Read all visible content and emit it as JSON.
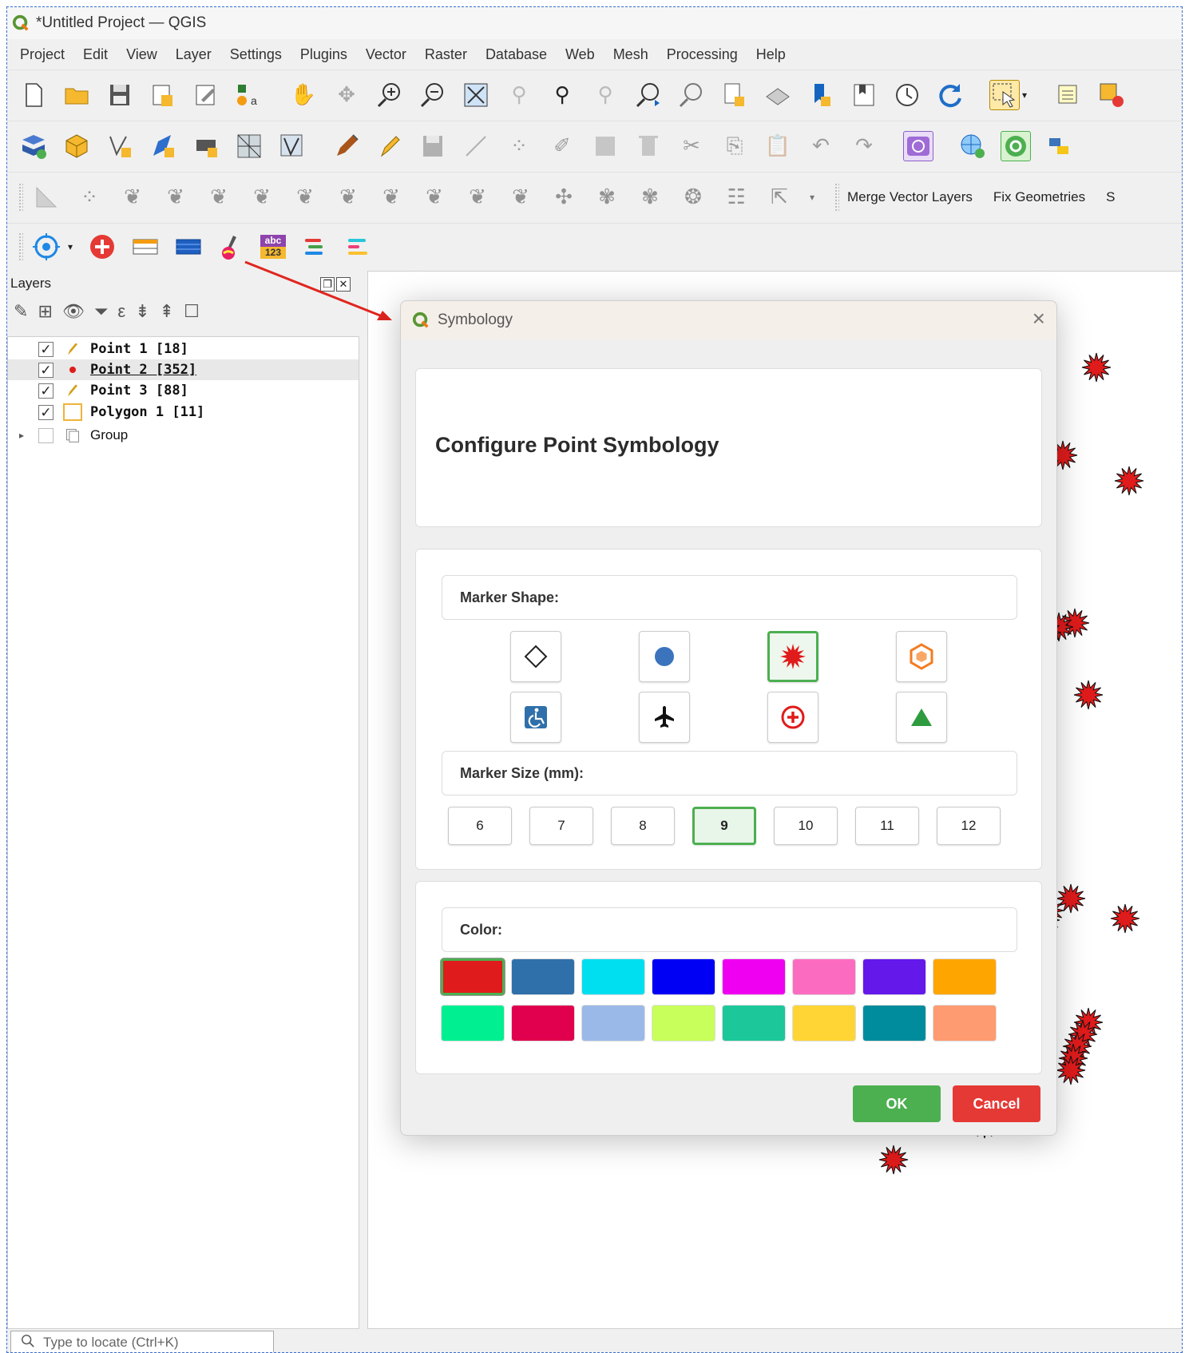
{
  "window": {
    "title": "*Untitled Project — QGIS"
  },
  "menu": [
    "Project",
    "Edit",
    "View",
    "Layer",
    "Settings",
    "Plugins",
    "Vector",
    "Raster",
    "Database",
    "Web",
    "Mesh",
    "Processing",
    "Help"
  ],
  "toolbar3": {
    "merge_label": "Merge Vector Layers",
    "fix_label": "Fix Geometries",
    "clipped_label": "S"
  },
  "toolbar4": {
    "label_icon_top": "abc",
    "label_icon_bottom": "123"
  },
  "layers": {
    "title": "Layers",
    "items": [
      {
        "name": "Point 1 [18]",
        "checked": "✓",
        "icon": "pencil-icon"
      },
      {
        "name": "Point 2 [352]",
        "checked": "✓",
        "icon": "red-dot-icon"
      },
      {
        "name": "Point 3 [88]",
        "checked": "✓",
        "icon": "pencil-icon"
      },
      {
        "name": "Polygon 1 [11]",
        "checked": "✓",
        "icon": "polygon-icon"
      },
      {
        "name": "Group",
        "checked": "",
        "icon": "group-icon"
      }
    ]
  },
  "locator": {
    "placeholder": "Type to locate (Ctrl+K)"
  },
  "dialog": {
    "title": "Symbology",
    "heading": "Configure Point Symbology",
    "shape_label": "Marker Shape:",
    "shapes": [
      "diamond",
      "circle",
      "star",
      "hexagon",
      "wheelchair",
      "airplane",
      "plus-circle",
      "triangle"
    ],
    "selected_shape": "star",
    "size_label": "Marker Size (mm):",
    "sizes": [
      "6",
      "7",
      "8",
      "9",
      "10",
      "11",
      "12"
    ],
    "selected_size": "9",
    "color_label": "Color:",
    "colors": [
      "#e01b1b",
      "#2f70aa",
      "#00dff0",
      "#0000f5",
      "#f000f0",
      "#fb6cc0",
      "#6418ea",
      "#ffa500",
      "#00f091",
      "#e0004d",
      "#9ab9e8",
      "#c8ff5a",
      "#1cc79a",
      "#ffd535",
      "#008c9c",
      "#fe9b70"
    ],
    "selected_color": "#e01b1b",
    "ok_label": "OK",
    "cancel_label": "Cancel"
  },
  "colors": {
    "accent_green": "#4caf50",
    "cancel_red": "#e53935",
    "marker_red": "#e01b1b"
  }
}
